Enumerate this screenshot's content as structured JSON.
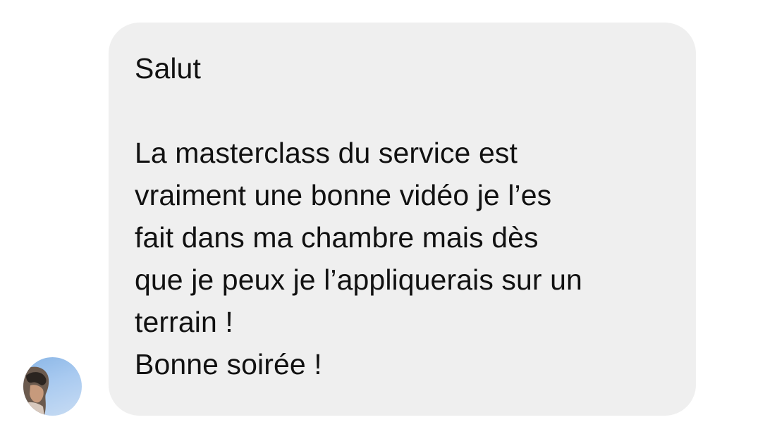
{
  "conversation": {
    "message": {
      "text": "Salut\n\nLa masterclass du service est\nvraiment une bonne vidéo je l’es\nfait dans ma chambre mais dès\nque je peux je l’appliquerais sur un\nterrain !\nBonne soirée !"
    },
    "sender": {
      "avatar_icon": "profile-photo"
    }
  },
  "colors": {
    "bubble_background": "#efefef",
    "text": "#111111",
    "page_background": "#ffffff"
  }
}
